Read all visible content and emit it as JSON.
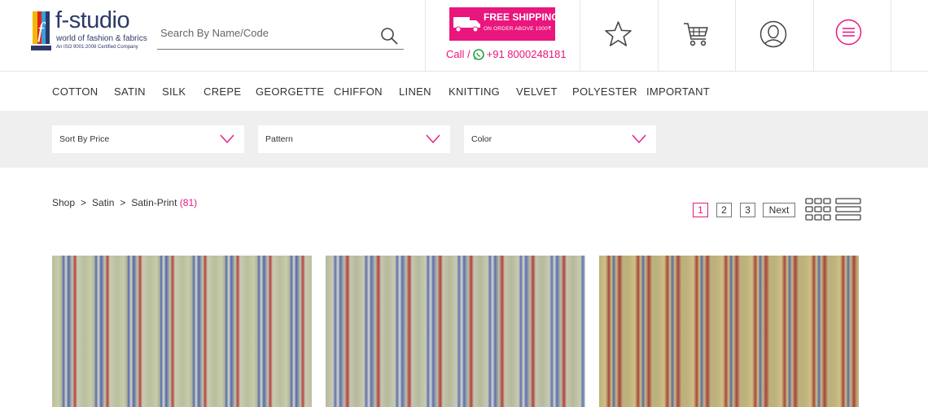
{
  "header": {
    "logo": {
      "title": "f-studio",
      "tagline": "world of fashion & fabrics",
      "iso": "An ISO 9001:2008 Certified Company"
    },
    "search": {
      "placeholder": "Search By Name/Code",
      "value": ""
    },
    "shipping": {
      "title": "FREE SHIPPING",
      "subtitle": "ON ORDER ABOVE 1000₹"
    },
    "call": {
      "label": "Call /",
      "phone": "+91 8000248181"
    },
    "icons": [
      "star-icon",
      "cart-icon",
      "user-icon",
      "menu-icon"
    ]
  },
  "categories": [
    "COTTON",
    "SATIN",
    "SILK",
    "CREPE",
    "GEORGETTE",
    "CHIFFON",
    "LINEN",
    "KNITTING",
    "VELVET",
    "POLYESTER",
    "IMPORTANT"
  ],
  "filters": [
    {
      "label": "Sort By Price"
    },
    {
      "label": "Pattern"
    },
    {
      "label": "Color"
    }
  ],
  "breadcrumb": {
    "items": [
      "Shop",
      "Satin",
      "Satin-Print"
    ],
    "separator": ">",
    "count": "(81)"
  },
  "pagination": {
    "pages": [
      "1",
      "2",
      "3"
    ],
    "current": "1",
    "next_label": "Next"
  },
  "view_modes": [
    "grid-view-icon",
    "list-view-icon"
  ],
  "products": [
    {
      "image": "striped-satin-print-1"
    },
    {
      "image": "striped-satin-print-2"
    },
    {
      "image": "striped-satin-print-3"
    }
  ],
  "colors": {
    "accent": "#e9167e",
    "brand": "#2b3a67",
    "filter_bg": "#efefef"
  }
}
